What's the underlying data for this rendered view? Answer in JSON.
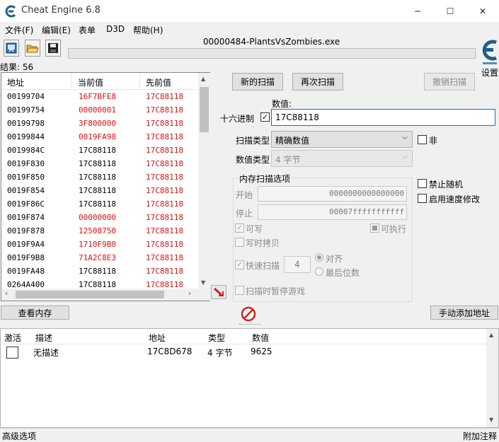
{
  "window": {
    "title": "Cheat Engine 6.8",
    "minimize_glyph": "─",
    "maximize_glyph": "☐",
    "close_glyph": "✕"
  },
  "menu": [
    "文件(F)",
    "编辑(E)",
    "表单",
    "D3D",
    "帮助(H)"
  ],
  "toolbar": {
    "icons": [
      "open-process-icon",
      "open-folder-icon",
      "save-icon"
    ],
    "process_title": "00000484-PlantsVsZombies.exe",
    "progress": 0,
    "settings_label": "设置"
  },
  "results": {
    "label": "结果: 56",
    "columns": [
      "地址",
      "当前值",
      "先前值"
    ],
    "rows": [
      {
        "address": "00199704",
        "current": "16F7BFE8",
        "previous": "17C88118",
        "changed": true
      },
      {
        "address": "00199754",
        "current": "00000001",
        "previous": "17C88118",
        "changed": true
      },
      {
        "address": "00199798",
        "current": "3F800000",
        "previous": "17C88118",
        "changed": true
      },
      {
        "address": "00199844",
        "current": "0019FA98",
        "previous": "17C88118",
        "changed": true
      },
      {
        "address": "0019984C",
        "current": "17C88118",
        "previous": "17C88118",
        "changed": false
      },
      {
        "address": "0019F830",
        "current": "17C88118",
        "previous": "17C88118",
        "changed": false
      },
      {
        "address": "0019F850",
        "current": "17C88118",
        "previous": "17C88118",
        "changed": false
      },
      {
        "address": "0019F854",
        "current": "17C88118",
        "previous": "17C88118",
        "changed": false
      },
      {
        "address": "0019F86C",
        "current": "17C88118",
        "previous": "17C88118",
        "changed": false
      },
      {
        "address": "0019F874",
        "current": "00000000",
        "previous": "17C88118",
        "changed": true
      },
      {
        "address": "0019F878",
        "current": "12508750",
        "previous": "17C88118",
        "changed": true
      },
      {
        "address": "0019F9A4",
        "current": "1710F9B0",
        "previous": "17C88118",
        "changed": true
      },
      {
        "address": "0019F9B8",
        "current": "71A2C8E3",
        "previous": "17C88118",
        "changed": true
      },
      {
        "address": "0019FA48",
        "current": "17C88118",
        "previous": "17C88118",
        "changed": false
      },
      {
        "address": "0264A400",
        "current": "17C88118",
        "previous": "17C88118",
        "changed": false
      }
    ]
  },
  "scan": {
    "new_scan": "新的扫描",
    "next_scan": "再次扫描",
    "undo_scan": "撤销扫描",
    "value_label": "数值:",
    "hex_label": "十六进制",
    "hex_checked": true,
    "value": "17C88118",
    "scan_type_label": "扫描类型",
    "scan_type": "精确数值",
    "not_label": "非",
    "value_type_label": "数值类型",
    "value_type": "4 字节"
  },
  "memory_options": {
    "title": "内存扫描选项",
    "start_label": "开始",
    "start_value": "0000000000000000",
    "stop_label": "停止",
    "stop_value": "00007fffffffffff",
    "writable_label": "可写",
    "executable_label": "可执行",
    "copy_on_write_label": "写时拷贝",
    "fast_scan_label": "快速扫描",
    "fast_scan_value": "4",
    "align_label": "对齐",
    "last_digits_label": "最后位数",
    "pause_label": "扫描时暂停游戏"
  },
  "side_options": {
    "no_random_label": "禁止随机",
    "speedhack_label": "启用速度修改"
  },
  "buttons": {
    "view_memory": "查看内存",
    "add_address": "手动添加地址"
  },
  "address_list": {
    "columns": [
      "激活",
      "描述",
      "地址",
      "类型",
      "数值"
    ],
    "rows": [
      {
        "active": false,
        "description": "无描述",
        "address": "17C8D678",
        "type": "4 字节",
        "value": "9625"
      }
    ]
  },
  "status": {
    "advanced": "高级选项",
    "comments": "附加注释"
  },
  "colors": {
    "changed_value": "#e01010",
    "accent_blue": "#0078d7"
  }
}
